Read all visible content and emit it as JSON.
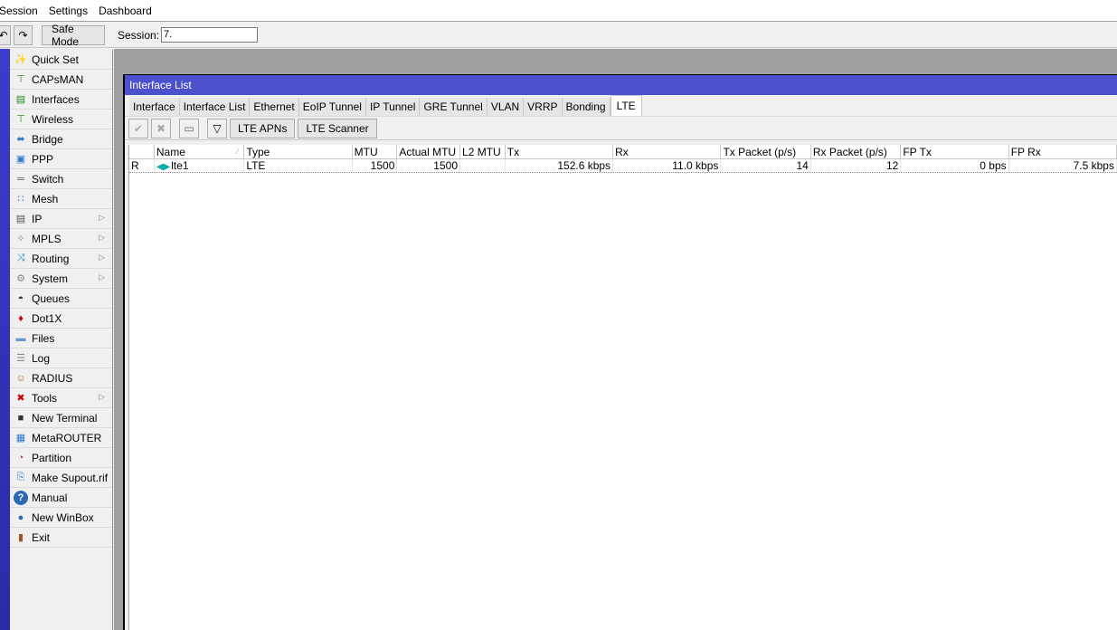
{
  "menubar": {
    "items": [
      "Session",
      "Settings",
      "Dashboard"
    ]
  },
  "toolbar": {
    "undo_icon": "undo-icon",
    "redo_icon": "redo-icon",
    "safe_mode_label": "Safe Mode",
    "session_label": "Session:",
    "session_value": "7."
  },
  "sidebar": {
    "items": [
      {
        "label": "Quick Set",
        "icon": "quick-set-icon",
        "submenu": false
      },
      {
        "label": "CAPsMAN",
        "icon": "capsman-icon",
        "submenu": false
      },
      {
        "label": "Interfaces",
        "icon": "interfaces-icon",
        "submenu": false
      },
      {
        "label": "Wireless",
        "icon": "wireless-icon",
        "submenu": false
      },
      {
        "label": "Bridge",
        "icon": "bridge-icon",
        "submenu": false
      },
      {
        "label": "PPP",
        "icon": "ppp-icon",
        "submenu": false
      },
      {
        "label": "Switch",
        "icon": "switch-icon",
        "submenu": false
      },
      {
        "label": "Mesh",
        "icon": "mesh-icon",
        "submenu": false
      },
      {
        "label": "IP",
        "icon": "ip-icon",
        "submenu": true
      },
      {
        "label": "MPLS",
        "icon": "mpls-icon",
        "submenu": true
      },
      {
        "label": "Routing",
        "icon": "routing-icon",
        "submenu": true
      },
      {
        "label": "System",
        "icon": "system-icon",
        "submenu": true
      },
      {
        "label": "Queues",
        "icon": "queues-icon",
        "submenu": false
      },
      {
        "label": "Dot1X",
        "icon": "dot1x-icon",
        "submenu": false
      },
      {
        "label": "Files",
        "icon": "files-icon",
        "submenu": false
      },
      {
        "label": "Log",
        "icon": "log-icon",
        "submenu": false
      },
      {
        "label": "RADIUS",
        "icon": "radius-icon",
        "submenu": false
      },
      {
        "label": "Tools",
        "icon": "tools-icon",
        "submenu": true
      },
      {
        "label": "New Terminal",
        "icon": "terminal-icon",
        "submenu": false
      },
      {
        "label": "MetaROUTER",
        "icon": "metarouter-icon",
        "submenu": false
      },
      {
        "label": "Partition",
        "icon": "partition-icon",
        "submenu": false
      },
      {
        "label": "Make Supout.rif",
        "icon": "supout-icon",
        "submenu": false
      },
      {
        "label": "Manual",
        "icon": "manual-icon",
        "submenu": false
      },
      {
        "label": "New WinBox",
        "icon": "winbox-icon",
        "submenu": false
      },
      {
        "label": "Exit",
        "icon": "exit-icon",
        "submenu": false
      }
    ]
  },
  "window": {
    "title": "Interface List",
    "tabs": [
      "Interface",
      "Interface List",
      "Ethernet",
      "EoIP Tunnel",
      "IP Tunnel",
      "GRE Tunnel",
      "VLAN",
      "VRRP",
      "Bonding",
      "LTE"
    ],
    "active_tab": "LTE",
    "toolbar": {
      "enable_icon": "check-icon",
      "disable_icon": "x-icon",
      "comment_icon": "comment-icon",
      "filter_icon": "filter-icon",
      "lte_apns_label": "LTE APNs",
      "lte_scanner_label": "LTE Scanner"
    },
    "table": {
      "columns": [
        "",
        "Name",
        "Type",
        "MTU",
        "Actual MTU",
        "L2 MTU",
        "Tx",
        "Rx",
        "Tx Packet (p/s)",
        "Rx Packet (p/s)",
        "FP Tx",
        "FP Rx"
      ],
      "sorted_column": "Name",
      "rows": [
        {
          "flag": "R",
          "name": "lte1",
          "type": "LTE",
          "mtu": "1500",
          "actual_mtu": "1500",
          "l2_mtu": "",
          "tx": "152.6 kbps",
          "rx": "11.0 kbps",
          "tx_packet": "14",
          "rx_packet": "12",
          "fp_tx": "0 bps",
          "fp_rx": "7.5 kbps"
        }
      ]
    }
  }
}
